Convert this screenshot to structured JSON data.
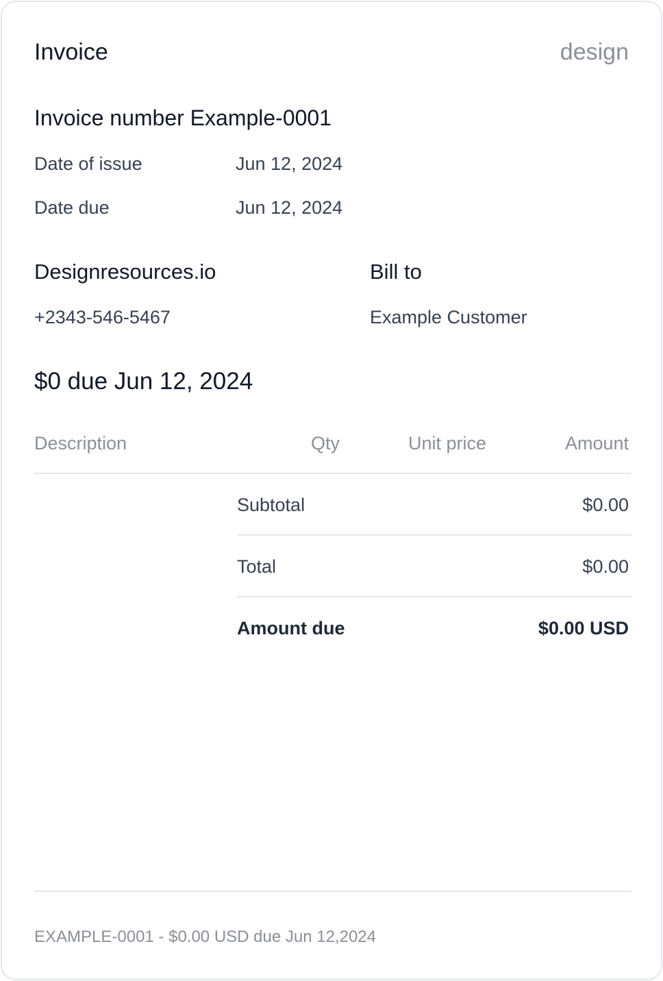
{
  "header": {
    "title": "Invoice",
    "brand": "design"
  },
  "invoice": {
    "number_line": "Invoice number Example-0001",
    "issue_label": "Date of issue",
    "issue_value": "Jun 12, 2024",
    "due_label": "Date due",
    "due_value": "Jun 12, 2024"
  },
  "from": {
    "name": "Designresources.io",
    "phone": "+2343-546-5467"
  },
  "bill_to": {
    "heading": "Bill to",
    "name": "Example Customer"
  },
  "due_headline": "$0 due Jun 12, 2024",
  "table": {
    "columns": [
      "Description",
      "Qty",
      "Unit price",
      "Amount"
    ]
  },
  "summary": {
    "subtotal_label": "Subtotal",
    "subtotal_value": "$0.00",
    "total_label": "Total",
    "total_value": "$0.00",
    "amount_due_label": "Amount due",
    "amount_due_value": "$0.00 USD"
  },
  "footer": {
    "text": "EXAMPLE-0001 - $0.00 USD due Jun 12,2024"
  }
}
